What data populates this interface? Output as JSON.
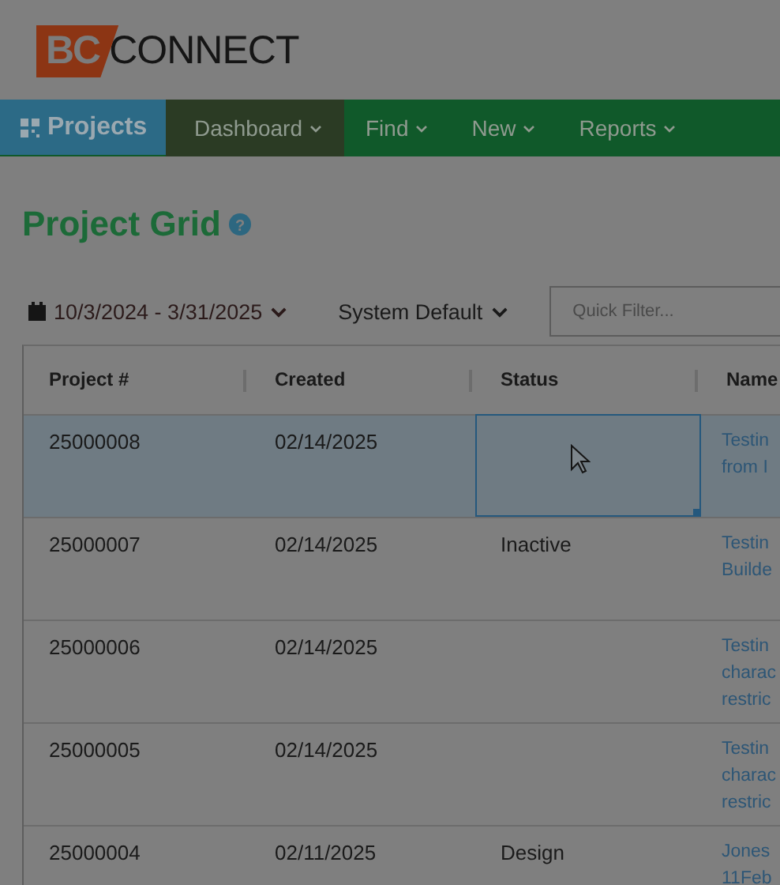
{
  "logo": {
    "mark": "BC",
    "text": "CONNECT"
  },
  "nav": {
    "module": "Projects",
    "items": [
      {
        "label": "Dashboard",
        "selected": true
      },
      {
        "label": "Find",
        "selected": false
      },
      {
        "label": "New",
        "selected": false
      },
      {
        "label": "Reports",
        "selected": false
      }
    ]
  },
  "page_title": "Project Grid",
  "help_icon": "?",
  "filters": {
    "date_range": "10/3/2024 - 3/31/2025",
    "view": "System Default",
    "quick_filter": {
      "placeholder": "Quick Filter..."
    }
  },
  "table": {
    "columns": [
      "Project #",
      "Created",
      "Status",
      "Name"
    ],
    "rows": [
      {
        "project": "25000008",
        "created": "02/14/2025",
        "name": [
          "Testin",
          "from I"
        ],
        "selected": true,
        "status_focused": true
      },
      {
        "project": "25000007",
        "created": "02/14/2025",
        "status": "Inactive",
        "name": [
          "Testin",
          "Builde"
        ],
        "selected": false,
        "status_focused": false
      },
      {
        "project": "25000006",
        "created": "02/14/2025",
        "name": [
          "Testin",
          "charac",
          "restric"
        ],
        "selected": false,
        "status_focused": false
      },
      {
        "project": "25000005",
        "created": "02/14/2025",
        "name": [
          "Testin",
          "charac",
          "restric"
        ],
        "selected": false,
        "status_focused": false
      },
      {
        "project": "25000004",
        "created": "02/11/2025",
        "status": "Design",
        "name": [
          "Jones",
          "11Feb"
        ],
        "selected": false,
        "status_focused": false
      }
    ]
  }
}
